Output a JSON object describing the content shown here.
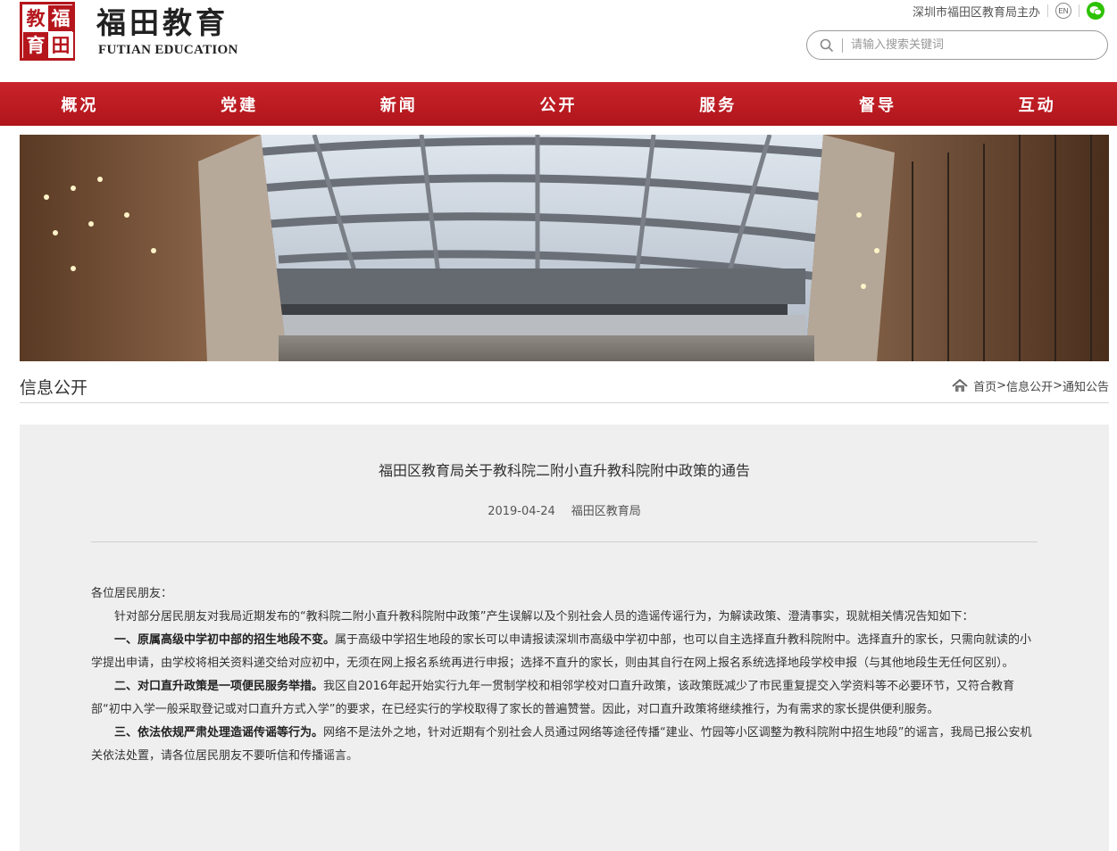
{
  "header": {
    "logo_chars": [
      "教",
      "福",
      "育",
      "田"
    ],
    "site_title": "福田教育",
    "site_subtitle": "FUTIAN EDUCATION",
    "host_text": "深圳市福田区教育局主办",
    "en_label": "EN",
    "search_placeholder": "请输入搜索关键词"
  },
  "nav": {
    "items": [
      "概况",
      "党建",
      "新闻",
      "公开",
      "服务",
      "督导",
      "互动"
    ]
  },
  "section": {
    "title": "信息公开",
    "breadcrumb": [
      "首页",
      "信息公开",
      "通知公告"
    ],
    "breadcrumb_sep": ">"
  },
  "article": {
    "title": "福田区教育局关于教科院二附小直升教科院附中政策的通告",
    "date": "2019-04-24",
    "source": "福田区教育局",
    "greeting": "各位居民朋友：",
    "intro": "针对部分居民朋友对我局近期发布的“教科院二附小直升教科院附中政策”产生误解以及个别社会人员的造谣传谣行为，为解读政策、澄清事实，现就相关情况告知如下：",
    "points": [
      {
        "heading": "一、原属高级中学初中部的招生地段不变。",
        "text": "属于高级中学招生地段的家长可以申请报读深圳市高级中学初中部，也可以自主选择直升教科院附中。选择直升的家长，只需向就读的小学提出申请，由学校将相关资料递交给对应初中，无须在网上报名系统再进行申报；选择不直升的家长，则由其自行在网上报名系统选择地段学校申报（与其他地段生无任何区别）。"
      },
      {
        "heading": "二、对口直升政策是一项便民服务举措。",
        "text": "我区自2016年起开始实行九年一贯制学校和相邻学校对口直升政策，该政策既减少了市民重复提交入学资料等不必要环节，又符合教育部“初中入学一般采取登记或对口直升方式入学”的要求，在已经实行的学校取得了家长的普遍赞誉。因此，对口直升政策将继续推行，为有需求的家长提供便利服务。"
      },
      {
        "heading": "三、依法依规严肃处理造谣传谣等行为。",
        "text": "网络不是法外之地，针对近期有个别社会人员通过网络等途径传播“建业、竹园等小区调整为教科院附中招生地段”的谣言，我局已报公安机关依法处置，请各位居民朋友不要听信和传播谣言。"
      }
    ]
  },
  "colors": {
    "brand_red": "#b5161c",
    "article_bg": "#efefef",
    "wechat_green": "#2dc100"
  }
}
